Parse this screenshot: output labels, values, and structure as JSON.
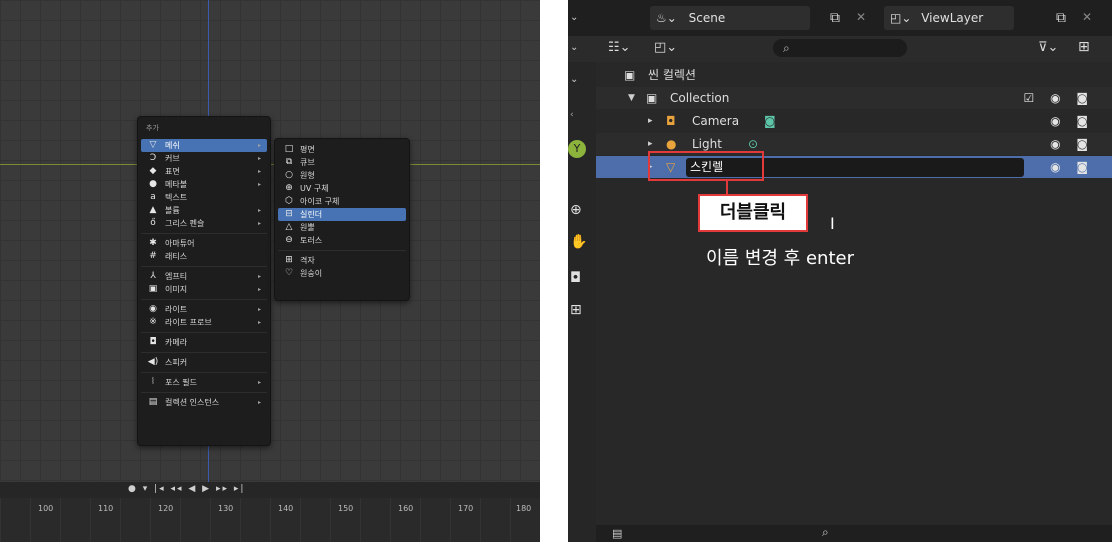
{
  "viewport": {
    "add_menu": {
      "title": "추가",
      "items": [
        {
          "icon": "▽",
          "label": "메쉬",
          "arrow": "▸"
        },
        {
          "icon": "Ↄ",
          "label": "커브",
          "arrow": "▸"
        },
        {
          "icon": "◆",
          "label": "표면",
          "arrow": "▸"
        },
        {
          "icon": "●",
          "label": "메타볼",
          "arrow": "▸"
        },
        {
          "icon": "a",
          "label": "텍스트",
          "arrow": ""
        },
        {
          "icon": "▲",
          "label": "볼륨",
          "arrow": "▸"
        },
        {
          "icon": "ő",
          "label": "그리스 펜슬",
          "arrow": "▸"
        },
        {
          "icon": "✱",
          "label": "아마튜어",
          "arrow": ""
        },
        {
          "icon": "#",
          "label": "래티스",
          "arrow": ""
        },
        {
          "icon": "⅄",
          "label": "엠프티",
          "arrow": "▸"
        },
        {
          "icon": "▣",
          "label": "이미지",
          "arrow": "▸"
        },
        {
          "icon": "◉",
          "label": "라이트",
          "arrow": "▸"
        },
        {
          "icon": "※",
          "label": "라이트 프로브",
          "arrow": "▸"
        },
        {
          "icon": "◘",
          "label": "카메라",
          "arrow": ""
        },
        {
          "icon": "◀)",
          "label": "스피커",
          "arrow": ""
        },
        {
          "icon": "⦚",
          "label": "포스 필드",
          "arrow": "▸"
        },
        {
          "icon": "▤",
          "label": "컬렉션 인스턴스",
          "arrow": "▸"
        }
      ]
    },
    "mesh_submenu": {
      "items": [
        {
          "icon": "□",
          "label": "평면"
        },
        {
          "icon": "⧉",
          "label": "큐브"
        },
        {
          "icon": "○",
          "label": "원형"
        },
        {
          "icon": "⊕",
          "label": "UV 구체"
        },
        {
          "icon": "⬡",
          "label": "아이코 구체"
        },
        {
          "icon": "⊟",
          "label": "실린더"
        },
        {
          "icon": "△",
          "label": "원뿔"
        },
        {
          "icon": "⊖",
          "label": "토러스"
        },
        {
          "icon": "⊞",
          "label": "격자"
        },
        {
          "icon": "♡",
          "label": "원숭이"
        }
      ]
    },
    "timeline": {
      "controls": "● ▾  |◂ ◂◂ ◀ ▶ ▸▸ ▸|",
      "ticks": [
        "100",
        "110",
        "120",
        "130",
        "140",
        "150",
        "160",
        "170",
        "180"
      ]
    }
  },
  "outliner": {
    "scene_label": "Scene",
    "viewlayer_label": "ViewLayer",
    "search_icon": "⌕",
    "scene_collection": "씬 컬렉션",
    "rows": [
      {
        "name": "Collection",
        "icons": "☑ ◉ ◙"
      },
      {
        "name": "Camera",
        "icons": "◉ ◙"
      },
      {
        "name": "Light",
        "icons": "◉ ◙"
      },
      {
        "name": "스킨렐",
        "icons": "◉ ◙"
      }
    ],
    "annotation": {
      "callout": "더블클릭",
      "instruction": "이름 변경 후 enter"
    }
  },
  "colors": {
    "selection": "#4772b3",
    "outliner_selection": "#4d6eab",
    "annotation_red": "#e23a3a"
  }
}
